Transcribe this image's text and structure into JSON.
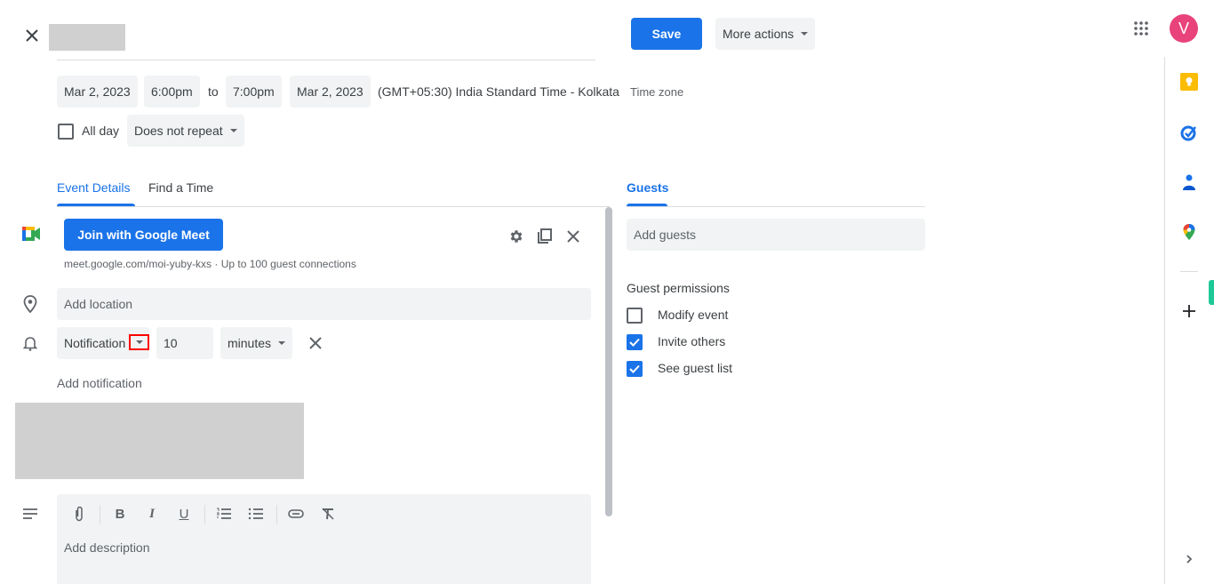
{
  "header": {
    "close_label": "Close",
    "save_label": "Save",
    "more_actions_label": "More actions",
    "avatar_initial": "V"
  },
  "datetime": {
    "start_date": "Mar 2, 2023",
    "start_time": "6:00pm",
    "to_label": "to",
    "end_time": "7:00pm",
    "end_date": "Mar 2, 2023",
    "timezone": "(GMT+05:30) India Standard Time - Kolkata",
    "timezone_link": "Time zone",
    "all_day_label": "All day",
    "all_day_checked": false,
    "repeat_value": "Does not repeat"
  },
  "tabs": {
    "event_details": "Event Details",
    "find_a_time": "Find a Time",
    "active": "Event Details"
  },
  "meet": {
    "join_label": "Join with Google Meet",
    "info": "meet.google.com/moi-yuby-kxs · Up to 100 guest connections"
  },
  "location": {
    "placeholder": "Add location"
  },
  "notification": {
    "type": "Notification",
    "amount": "10",
    "unit": "minutes",
    "add_label": "Add notification"
  },
  "description": {
    "placeholder": "Add description"
  },
  "guests": {
    "tab_label": "Guests",
    "placeholder": "Add guests",
    "permissions_label": "Guest permissions",
    "permissions": [
      {
        "label": "Modify event",
        "checked": false
      },
      {
        "label": "Invite others",
        "checked": true
      },
      {
        "label": "See guest list",
        "checked": true
      }
    ]
  },
  "side_panel": {
    "apps": [
      "keep-icon",
      "tasks-icon",
      "contacts-icon",
      "maps-icon"
    ],
    "add_label": "Get add-ons",
    "expand_label": "Show side panel"
  },
  "colors": {
    "accent": "#1a73e8",
    "avatar": "#e8437a",
    "chip_bg": "#f1f3f4",
    "redacted": "#d0d0d0",
    "highlight": "#ff0000"
  }
}
